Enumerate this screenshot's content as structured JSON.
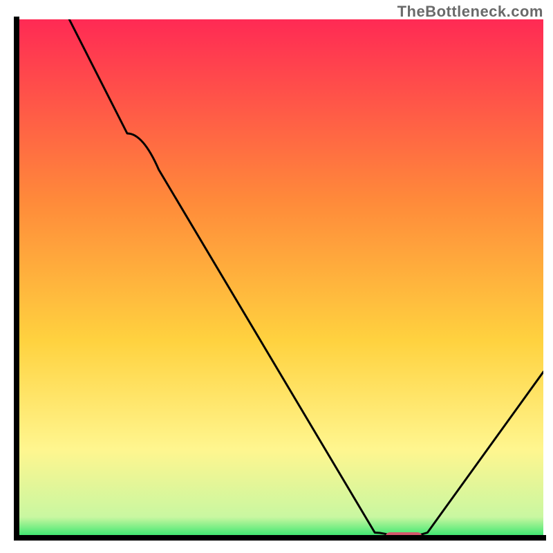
{
  "watermark": "TheBottleneck.com",
  "colors": {
    "gradient_top": "#ff2a54",
    "gradient_mid1": "#ff6a3a",
    "gradient_mid2": "#ffd23f",
    "gradient_mid3": "#fff68f",
    "gradient_bottom": "#2ee56b",
    "curve": "#000000",
    "axis": "#000000",
    "marker": "#d4586d"
  },
  "chart_data": {
    "type": "line",
    "title": "",
    "xlabel": "",
    "ylabel": "",
    "xlim": [
      0,
      100
    ],
    "ylim": [
      0,
      100
    ],
    "grid": false,
    "legend": false,
    "x": [
      10,
      21,
      27,
      68,
      72,
      78,
      100
    ],
    "values": [
      100,
      78,
      71,
      1,
      0,
      1,
      32
    ],
    "marker": {
      "x_start": 70,
      "x_end": 77,
      "y": 0
    },
    "note": "Values read off the image as percentages of the plotting area. The curve descends from top-left, flattens near the bottom around x≈70–77, then rises toward the right edge. No numeric axis ticks are visible."
  }
}
